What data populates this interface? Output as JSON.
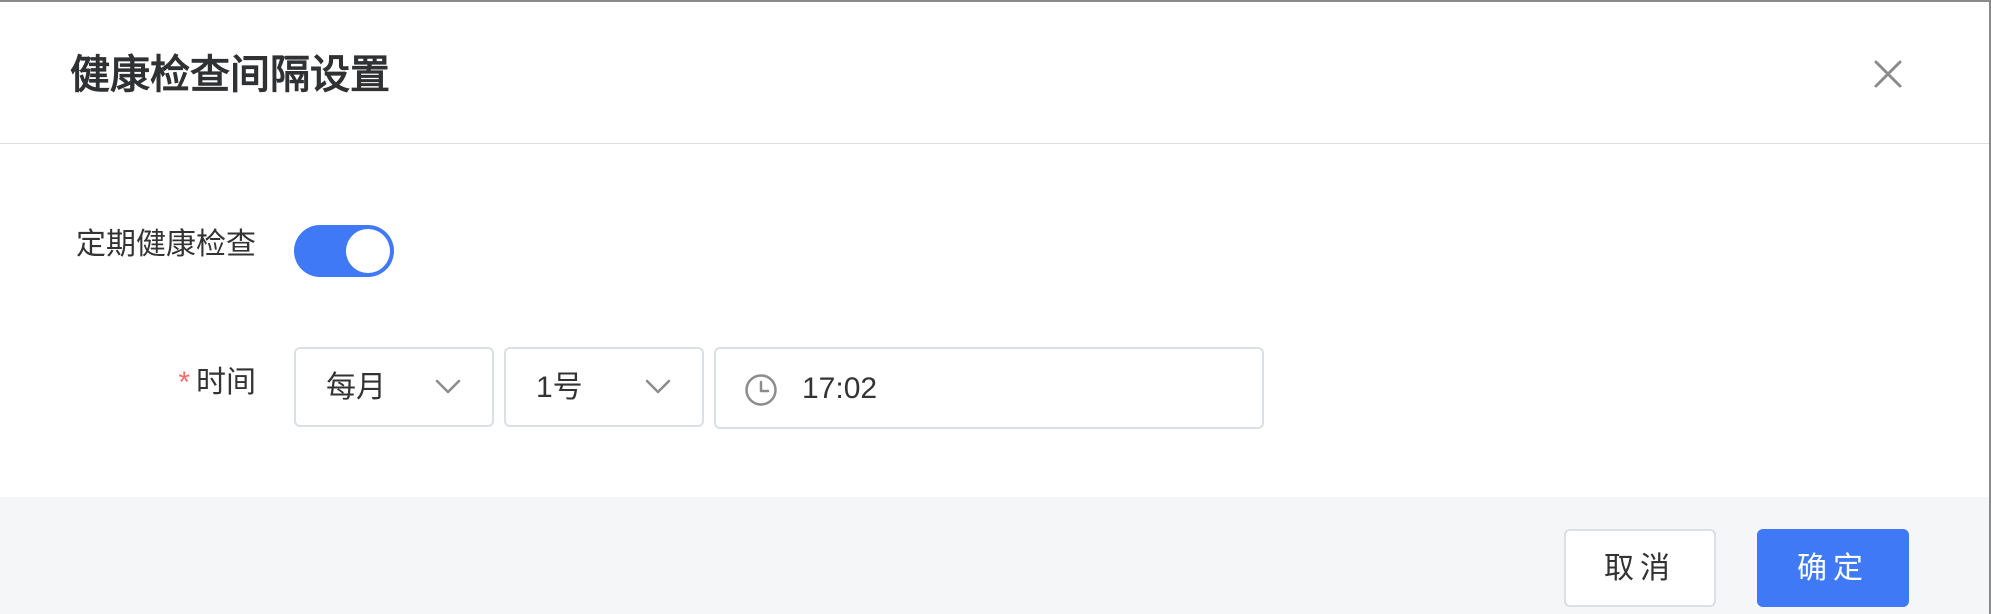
{
  "dialog": {
    "title": "健康检查间隔设置",
    "close_icon": "close-icon"
  },
  "form": {
    "periodic_check": {
      "label": "定期健康检查",
      "enabled": true,
      "toggle_color": "#3f79f5"
    },
    "time": {
      "required_mark": "*",
      "label": "时间",
      "frequency_value": "每月",
      "day_value": "1号",
      "time_value": "17:02",
      "clock_icon": "clock-icon",
      "chevron_icon": "chevron-down-icon"
    }
  },
  "footer": {
    "cancel_label": "取消",
    "confirm_label": "确定",
    "accent_color": "#3f79f5",
    "background": "#f5f6f8"
  }
}
